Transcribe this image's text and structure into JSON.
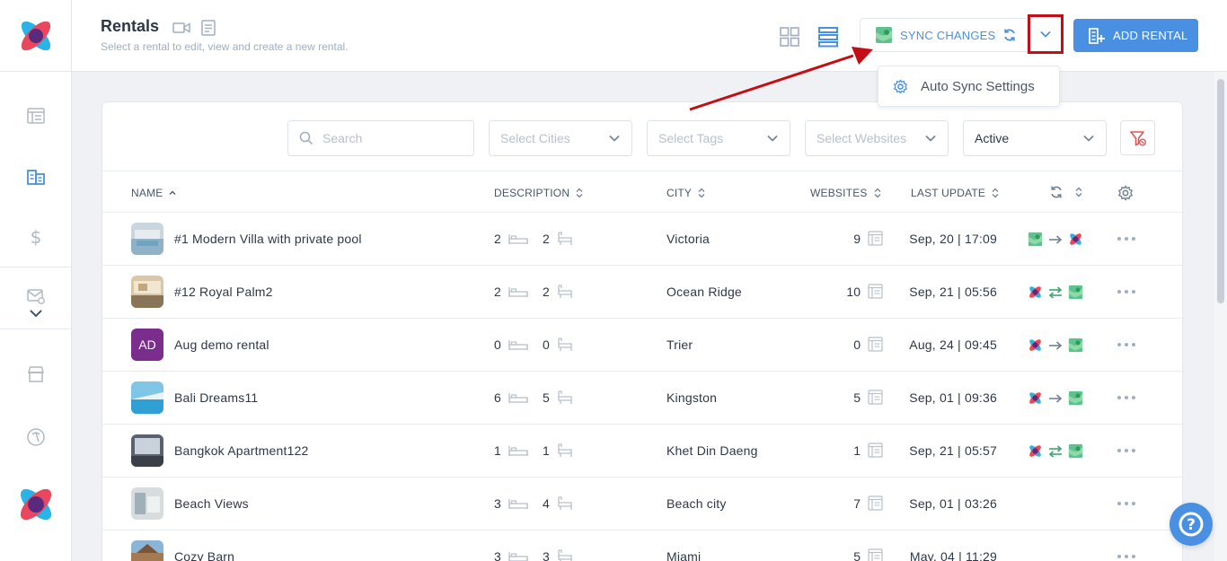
{
  "sidebar": {
    "icons": [
      "listing-icon",
      "rentals-icon",
      "dollar-icon",
      "mail-settings-icon",
      "chevron-down-icon",
      "store-icon",
      "beach-icon"
    ]
  },
  "header": {
    "title": "Rentals",
    "subtitle": "Select a rental to edit, view and create a new rental.",
    "sync_label": "SYNC CHANGES",
    "add_label": "ADD RENTAL"
  },
  "dropdown": {
    "item": "Auto Sync Settings"
  },
  "filters": {
    "search_placeholder": "Search",
    "cities_placeholder": "Select Cities",
    "tags_placeholder": "Select Tags",
    "websites_placeholder": "Select Websites",
    "status_value": "Active"
  },
  "columns": {
    "name": "NAME",
    "description": "DESCRIPTION",
    "city": "CITY",
    "websites": "WEBSITES",
    "last_update": "LAST UPDATE"
  },
  "rows": [
    {
      "name": "#1 Modern Villa with private pool",
      "beds": "2",
      "baths": "2",
      "city": "Victoria",
      "websites": "9",
      "updated": "Sep, 20 | 17:09",
      "sync": "to-rentals"
    },
    {
      "name": "#12 Royal Palm2",
      "beds": "2",
      "baths": "2",
      "city": "Ocean Ridge",
      "websites": "10",
      "updated": "Sep, 21 | 05:56",
      "sync": "both"
    },
    {
      "name": "Aug demo rental",
      "initials": "AD",
      "beds": "0",
      "baths": "0",
      "city": "Trier",
      "websites": "0",
      "updated": "Aug, 24 | 09:45",
      "sync": "to-sites"
    },
    {
      "name": "Bali Dreams11",
      "beds": "6",
      "baths": "5",
      "city": "Kingston",
      "websites": "5",
      "updated": "Sep, 01 | 09:36",
      "sync": "to-sites"
    },
    {
      "name": "Bangkok Apartment122",
      "beds": "1",
      "baths": "1",
      "city": "Khet Din Daeng",
      "websites": "1",
      "updated": "Sep, 21 | 05:57",
      "sync": "both"
    },
    {
      "name": "Beach Views",
      "beds": "3",
      "baths": "4",
      "city": "Beach city",
      "websites": "7",
      "updated": "Sep, 01 | 03:26",
      "sync": "none"
    },
    {
      "name": "Cozy Barn",
      "beds": "3",
      "baths": "3",
      "city": "Miami",
      "websites": "5",
      "updated": "May, 04 | 11:29",
      "sync": "none"
    }
  ],
  "colors": {
    "accent": "#4a90e2",
    "highlight": "#c20e14",
    "avatar": "#7b2d8e"
  }
}
